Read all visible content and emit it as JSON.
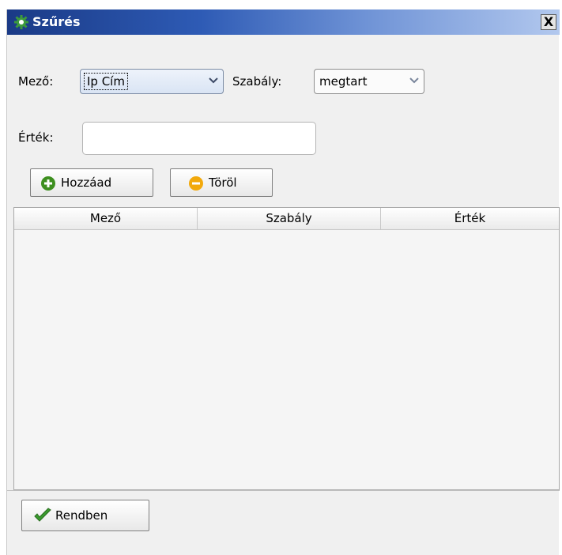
{
  "window": {
    "title": "Szűrés",
    "close_label": "X"
  },
  "form": {
    "field_label": "Mező:",
    "field_value": "Ip Cím",
    "rule_label": "Szabály:",
    "rule_value": "megtart",
    "value_label": "Érték:",
    "value_input": "",
    "value_placeholder": ""
  },
  "buttons": {
    "add": "Hozzáad",
    "delete": "Töröl",
    "ok": "Rendben"
  },
  "table": {
    "columns": [
      "Mező",
      "Szabály",
      "Érték"
    ],
    "rows": []
  },
  "colors": {
    "add_icon": "#3d8f1f",
    "delete_icon": "#f2a90c",
    "ok_check": "#3a9a2e",
    "title_icon": "#3c9a3c"
  },
  "icons": {
    "title": "gear-icon",
    "add": "plus-circle-icon",
    "delete": "minus-circle-icon",
    "ok": "checkmark-icon"
  }
}
